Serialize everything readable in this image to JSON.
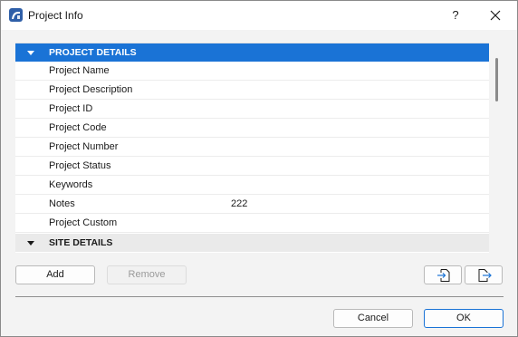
{
  "window": {
    "title": "Project Info",
    "help_label": "?"
  },
  "list": {
    "groups": [
      {
        "label": "PROJECT DETAILS",
        "rows": [
          {
            "name": "Project Name",
            "value": ""
          },
          {
            "name": "Project Description",
            "value": ""
          },
          {
            "name": "Project ID",
            "value": ""
          },
          {
            "name": "Project Code",
            "value": ""
          },
          {
            "name": "Project Number",
            "value": ""
          },
          {
            "name": "Project Status",
            "value": ""
          },
          {
            "name": "Keywords",
            "value": ""
          },
          {
            "name": "Notes",
            "value": "222"
          },
          {
            "name": "Project Custom",
            "value": ""
          }
        ]
      },
      {
        "label": "SITE DETAILS",
        "rows": []
      }
    ]
  },
  "buttons": {
    "add": "Add",
    "remove": "Remove",
    "cancel": "Cancel",
    "ok": "OK"
  },
  "icons": {
    "app": "archicad-app-icon",
    "close": "close-icon",
    "import": "import-icon",
    "export": "export-icon",
    "group_expand": "triangle-down-icon"
  },
  "colors": {
    "selection": "#1a73d6",
    "group_header": "#eaeaea",
    "primary_border": "#1a73d6"
  }
}
